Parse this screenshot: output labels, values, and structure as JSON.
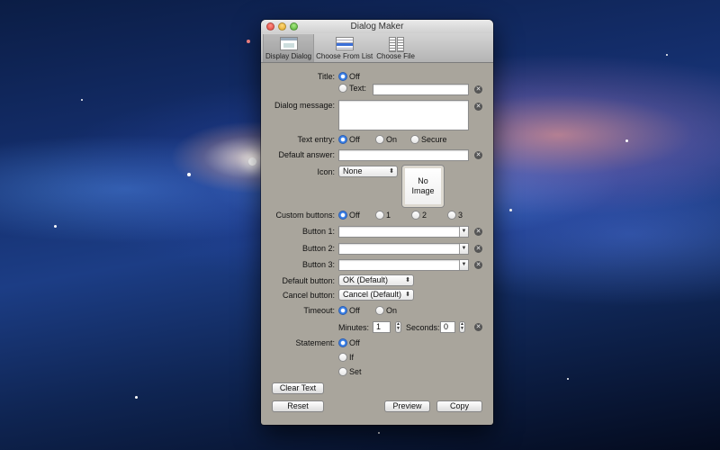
{
  "window": {
    "title": "Dialog Maker"
  },
  "toolbar": {
    "items": [
      {
        "label": "Display Dialog",
        "icon": "dialog-icon"
      },
      {
        "label": "Choose From List",
        "icon": "list-icon"
      },
      {
        "label": "Choose File",
        "icon": "file-icon"
      }
    ]
  },
  "form": {
    "title": {
      "label": "Title:",
      "opt_off": "Off",
      "opt_text": "Text:",
      "value": ""
    },
    "dialog_message": {
      "label": "Dialog message:",
      "value": ""
    },
    "text_entry": {
      "label": "Text entry:",
      "opt_off": "Off",
      "opt_on": "On",
      "opt_secure": "Secure"
    },
    "default_answer": {
      "label": "Default answer:",
      "value": ""
    },
    "icon": {
      "label": "Icon:",
      "selected": "None",
      "well_line1": "No",
      "well_line2": "Image"
    },
    "custom_buttons": {
      "label": "Custom buttons:",
      "opt_off": "Off",
      "opt_1": "1",
      "opt_2": "2",
      "opt_3": "3"
    },
    "button1": {
      "label": "Button 1:",
      "value": ""
    },
    "button2": {
      "label": "Button 2:",
      "value": ""
    },
    "button3": {
      "label": "Button 3:",
      "value": ""
    },
    "default_button": {
      "label": "Default button:",
      "selected": "OK (Default)"
    },
    "cancel_button": {
      "label": "Cancel button:",
      "selected": "Cancel (Default)"
    },
    "timeout": {
      "label": "Timeout:",
      "opt_off": "Off",
      "opt_on": "On",
      "minutes_label": "Minutes:",
      "minutes_value": "1",
      "seconds_label": "Seconds:",
      "seconds_value": "0"
    },
    "statement": {
      "label": "Statement:",
      "opt_off": "Off",
      "opt_if": "If",
      "opt_set": "Set"
    }
  },
  "actions": {
    "clear_text": "Clear Text",
    "reset": "Reset",
    "preview": "Preview",
    "copy": "Copy"
  },
  "colors": {
    "window_body": "#a9a59c",
    "radio_selected": "#3b80e6"
  }
}
